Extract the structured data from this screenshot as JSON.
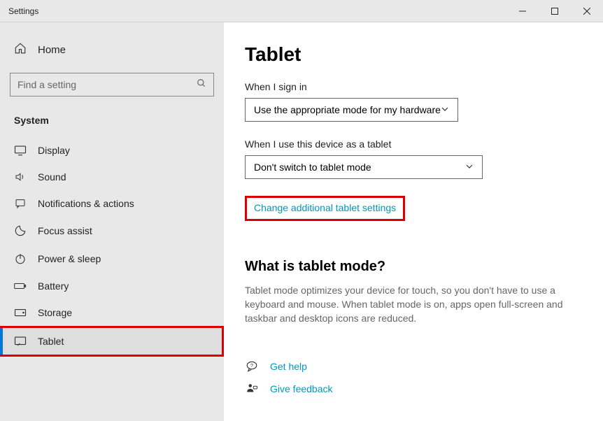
{
  "window": {
    "title": "Settings"
  },
  "sidebar": {
    "home": "Home",
    "search_placeholder": "Find a setting",
    "section": "System",
    "items": [
      {
        "label": "Display"
      },
      {
        "label": "Sound"
      },
      {
        "label": "Notifications & actions"
      },
      {
        "label": "Focus assist"
      },
      {
        "label": "Power & sleep"
      },
      {
        "label": "Battery"
      },
      {
        "label": "Storage"
      },
      {
        "label": "Tablet"
      }
    ]
  },
  "main": {
    "title": "Tablet",
    "signin_label": "When I sign in",
    "signin_value": "Use the appropriate mode for my hardware",
    "device_label": "When I use this device as a tablet",
    "device_value": "Don't switch to tablet mode",
    "change_link": "Change additional tablet settings",
    "what_head": "What is tablet mode?",
    "what_desc": "Tablet mode optimizes your device for touch, so you don't have to use a keyboard and mouse. When tablet mode is on, apps open full-screen and taskbar and desktop icons are reduced.",
    "help_link": "Get help",
    "feedback_link": "Give feedback"
  }
}
